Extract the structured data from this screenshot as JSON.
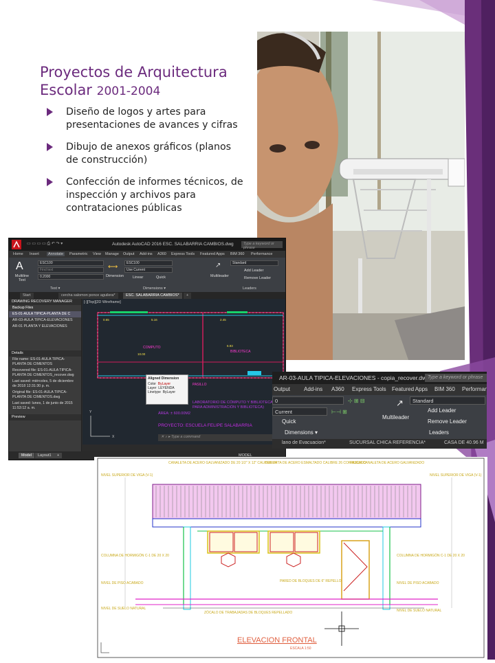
{
  "slide": {
    "title_main": "Proyectos de Arquitectura Escolar",
    "title_years": "2001-2004",
    "bullets": [
      "Diseño de logos y artes para presentaciones de avances y cifras",
      "Dibujo de anexos gráficos (planos de construcción)",
      "Confección de informes técnicos, de inspección y archivos para contrataciones públicas"
    ],
    "colors": {
      "accent": "#6b2a7d",
      "facet_dark": "#5b2a6a",
      "facet_light": "#9a4fb0"
    }
  },
  "acad1": {
    "title": "Autodesk AutoCAD 2016   ESC. SALABARRIA CAMBIOS.dwg",
    "search_placeholder": "Type a keyword or phrase",
    "menu": [
      "Home",
      "Insert",
      "Annotate",
      "Parametric",
      "View",
      "Manage",
      "Output",
      "Add-ins",
      "A360",
      "Express Tools",
      "Featured Apps",
      "BIM 360",
      "Performance"
    ],
    "ribbon": {
      "text_style": "ESC100",
      "text_font": "Find text",
      "text_height": "0.2000",
      "dim_style": "ESC100",
      "dim_current": "Use Current",
      "linear": "Linear",
      "quick": "Quick",
      "leader_style": "Standard",
      "add_leader": "Add Leader",
      "remove_leader": "Remove Leader",
      "multiline_text": "Multiline Text",
      "dimension": "Dimension",
      "multileader": "Multileader",
      "panel_text": "Text ▾",
      "panel_dimensions": "Dimensions ▾",
      "panel_leaders": "Leaders"
    },
    "doc_tabs": [
      "Start",
      "cercha salomon ponce aguilera*",
      "ESC. SALABARRIA CAMBIOS*"
    ],
    "recovery": {
      "header": "DRAWING RECOVERY MANAGER",
      "backup_label": "Backup Files",
      "files": [
        "ES-01-AULA TIPICA-PLANTA DE C",
        "AR-03-AULA TIPICA-ELEVACIONES",
        "AR-01 PLANTA Y ELEVACIONES"
      ],
      "details_header": "Details",
      "details": [
        "File name: ES-01-AULA TIPICA-PLANTA DE CIMENTOS",
        "Recovered file: ES-01-AULA TIPICA-PLANTA DE CIMENTOS_recover.dwg",
        "Last saved: miércoles, 5 de diciembre de 2018  12:31:30 p. m.",
        "Original file: ES-01-AULA TIPICA-PLANTA DE CIMENTOS.dwg",
        "Last saved: lunes, 1 de junio de 2015  11:53:12 a. m."
      ],
      "preview_header": "Preview"
    },
    "viewport_label": "[-][Top][2D Wireframe]",
    "drawing": {
      "rooms": [
        "COMPUTO",
        "BIBLIOTECA",
        "PASILLO"
      ],
      "note_lines": [
        "LABORATORIO DE CÓMPUTO Y BIBLIOTECA",
        "PARA ADMINISTRACIÓN Y BIBLIOTECA)"
      ],
      "area": "ÁREA:  ± 600.00M2",
      "project": "PROYECTO:   ESCUELA FELIPE SALABARRIA"
    },
    "tooltip": {
      "title": "Aligned Dimension",
      "rows": [
        [
          "Color",
          "ByLayer"
        ],
        [
          "Layer",
          "LEYENDA"
        ],
        [
          "Linetype",
          "ByLayer"
        ]
      ]
    },
    "command_placeholder": "Type a command",
    "layout_tabs": [
      "Model",
      "Layout1",
      "+"
    ],
    "status_model": "MODEL"
  },
  "acad2": {
    "title": "AR-03-AULA TIPICA-ELEVACIONES - copia_recover.dwg",
    "search_placeholder": "Type a keyword or phrase",
    "menu": [
      "Output",
      "Add-ins",
      "A360",
      "Express Tools",
      "Featured Apps",
      "BIM 360",
      "Performance"
    ],
    "dim_row1": "0",
    "dim_current": "Current",
    "quick": "Quick",
    "multileader": "Multileader",
    "leader_style": "Standard",
    "add_leader": "Add Leader",
    "remove_leader": "Remove Leader",
    "panel_dimensions": "Dimensions ▾",
    "panel_leaders": "Leaders",
    "doc_tabs": [
      "lano de Evacuacion*",
      "SUCURSAL CHICA REFERENCIA*",
      "CASA DE 40.96 M"
    ]
  },
  "elevation": {
    "title": "ELEVACION FRONTAL",
    "scale": "ESCALA 1:50",
    "labels": {
      "nivel_viga_left": "NIVEL SUPERIOR DE VIGA (V-1)",
      "nivel_viga_right": "NIVEL SUPERIOR DE VIGA (V-1)",
      "canaleta": "CANALETA DE ACERO GALVANIZADO DE 20 1/2\" X 12\" CALIBRE 24",
      "cubierta": "CUBIERTA DE ACERO ESMALTADO CALIBRE 26 CORRUGADO",
      "fascia": "FASCIA CANALETA DE ACERO GALVANIZADO",
      "columna_left": "COLUMNA DE HORMIGÓN C-1 DE 20 X 20",
      "columna_right": "COLUMNA DE HORMIGÓN C-1 DE 20 X 20",
      "nivel_piso_left": "NIVEL DE PISO ACABADO",
      "nivel_piso_right": "NIVEL DE PISO ACABADO",
      "nivel_suelo_left": "NIVEL DE SUELO NATURAL",
      "nivel_suelo_right": "NIVEL DE SUELO NATURAL",
      "bloques": "PARED DE BLOQUES DE 6\" REPELLO",
      "zocalo": "ZÓCALO DE TRABAJADAS DE BLOQUES REPELLADO"
    }
  }
}
